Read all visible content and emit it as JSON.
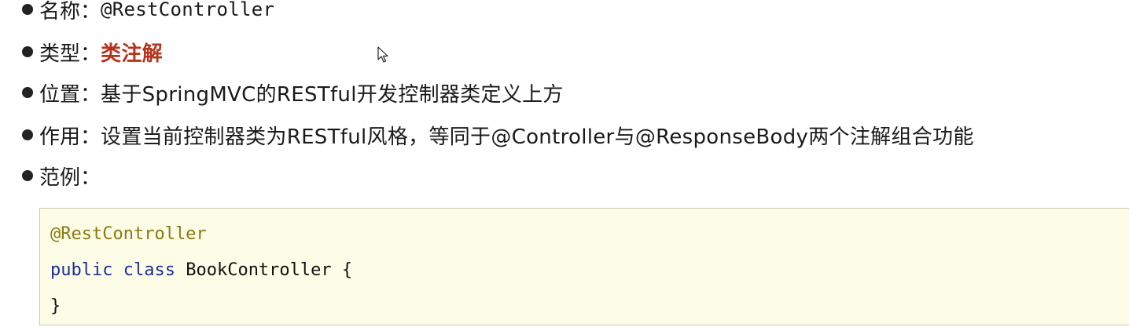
{
  "bullets": [
    {
      "label": "名称：",
      "value": "@RestController"
    },
    {
      "label": "类型：",
      "value": "类注解"
    },
    {
      "label": "位置：",
      "value": "基于SpringMVC的RESTful开发控制器类定义上方"
    },
    {
      "label": "作用：",
      "value": "设置当前控制器类为RESTful风格，等同于@Controller与@ResponseBody两个注解组合功能"
    },
    {
      "label": "范例：",
      "value": ""
    }
  ],
  "code": {
    "annotation": "@RestController",
    "keyword_public": "public",
    "keyword_class": "class",
    "class_decl": "BookController {",
    "closing": "}"
  },
  "colors": {
    "highlight": "#b4351c",
    "annotation": "#8a7a12",
    "keyword": "#1c2e96",
    "code_background": "#fdfce6"
  },
  "icons": {
    "cursor": "mouse-pointer-icon"
  }
}
